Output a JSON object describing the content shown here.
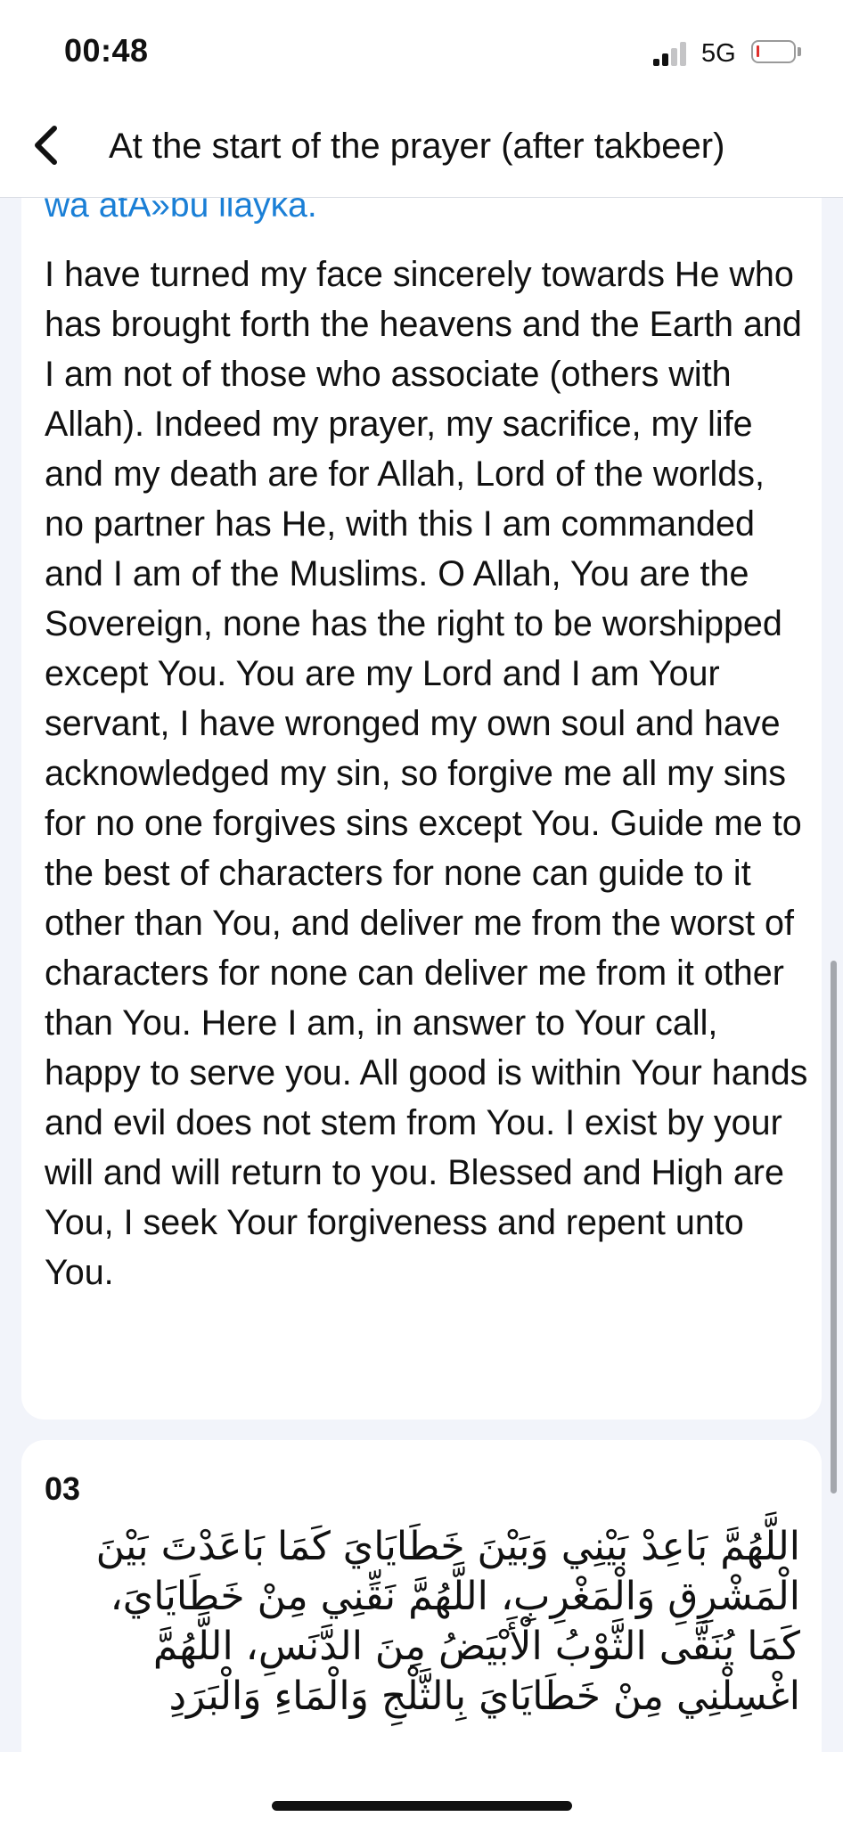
{
  "status_bar": {
    "time": "00:48",
    "network": "5G",
    "signal_bars_active": 2,
    "signal_bars_total": 4,
    "battery_level_percent": 5
  },
  "header": {
    "back_icon": "chevron-left-icon",
    "title": "At the start of the prayer (after takbeer)"
  },
  "cards": [
    {
      "transliteration_tail": "wa atA»bu ilayka.",
      "translation": "I have turned my face sincerely towards He who has brought forth the heavens and the Earth and I am not of those who associate (others with Allah). Indeed my prayer, my sacrifice, my life and my death are for Allah, Lord of the worlds, no partner has He, with this I am commanded and I am of the Muslims. O Allah, You are the Sovereign, none has the right to be worshipped except You. You are my Lord and I am Your servant, I have wronged my own soul and have acknowledged my sin, so forgive me all my sins for no one forgives sins except You. Guide me to the best of characters for none can guide to it other than You, and deliver me from the worst of characters for none can deliver me from it other than You. Here I am, in answer to Your call, happy to serve you. All good is within Your hands and evil does not stem from You. I exist by your will and will return to you. Blessed and High are You, I seek Your forgiveness and repent unto You."
    },
    {
      "number": "03",
      "arabic": "اللَّهُمَّ بَاعِدْ بَيْنِي وَبَيْنَ خَطَايَايَ كَمَا بَاعَدْتَ بَيْنَ الْمَشْرِقِ وَالْمَغْرِبِ، اللَّهُمَّ نَقِّنِي مِنْ خَطَايَايَ، كَمَا يُنَقَّى الثَّوْبُ الْأَبْيَضُ مِنَ الدَّنَسِ، اللَّهُمَّ اغْسِلْنِي مِنْ خَطَايَايَ بِالثَّلْجِ وَالْمَاءِ وَالْبَرَدِ"
    }
  ],
  "colors": {
    "accent_link": "#1a7fd6",
    "background": "#f2f4fa",
    "card": "#ffffff",
    "text": "#111111",
    "battery_low": "#e0302c"
  }
}
